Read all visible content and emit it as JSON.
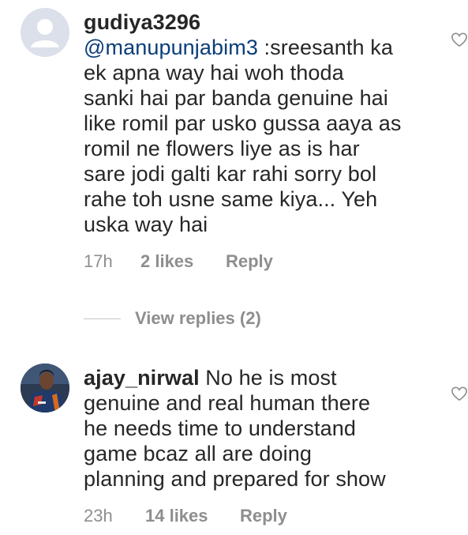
{
  "comments": [
    {
      "username": "gudiya3296",
      "mention": "@manupunjabim3",
      "text": " :sreesanth ka\nek apna way hai woh thoda\nsanki hai par banda genuine hai\nlike romil par usko gussa aaya as\nromil ne flowers liye as is har\nsare jodi galti kar rahi sorry bol\nrahe toh usne same kiya... Yeh\nuska way hai",
      "time": "17h",
      "likes": "2 likes",
      "reply": "Reply"
    },
    {
      "username": "ajay_nirwal",
      "text": " No he is most\ngenuine and real human there\nhe needs time to understand\ngame bcaz all are doing\nplanning and prepared for show",
      "time": "23h",
      "likes": "14 likes",
      "reply": "Reply"
    }
  ],
  "view_replies": "View replies (2)",
  "icons": {
    "like": "heart-outline-icon",
    "avatar_default": "default-avatar-icon"
  },
  "colors": {
    "text": "#262626",
    "meta": "#8e8e8e",
    "mention": "#0a3e7a",
    "avatar_placeholder": "#dbe0ea"
  }
}
